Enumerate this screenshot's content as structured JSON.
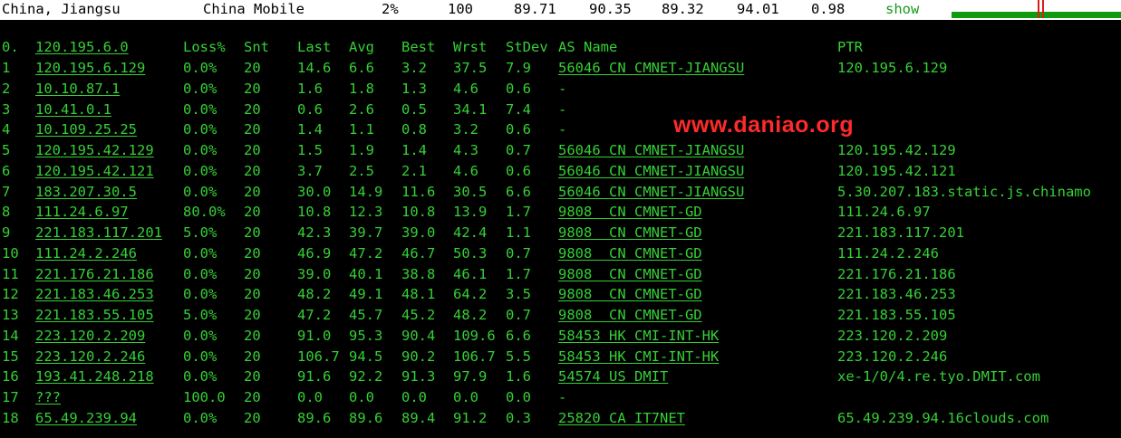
{
  "topbar": {
    "location": "China, Jiangsu",
    "isp": "China Mobile",
    "loss": "2%",
    "snt": "100",
    "last": "89.71",
    "avg": "90.35",
    "best": "89.32",
    "wrst": "94.01",
    "stdev": "0.98",
    "show_label": "show",
    "colors": {
      "track": "#0f9a0f",
      "mark": "#e01818"
    }
  },
  "headers": {
    "hop": "0.",
    "host": "120.195.6.0",
    "loss": "Loss%",
    "snt": "Snt",
    "last": "Last",
    "avg": "Avg",
    "best": "Best",
    "wrst": "Wrst",
    "stdev": "StDev",
    "as": "AS Name",
    "ptr": "PTR"
  },
  "watermark": "www.daniao.org",
  "rows": [
    {
      "hop": "1",
      "host": "120.195.6.129",
      "loss": "0.0%",
      "snt": "20",
      "last": "14.6",
      "avg": "6.6",
      "best": "3.2",
      "wrst": "37.5",
      "stdev": "7.9",
      "as": "56046 CN CMNET-JIANGSU",
      "ptr": "120.195.6.129"
    },
    {
      "hop": "2",
      "host": "10.10.87.1",
      "loss": "0.0%",
      "snt": "20",
      "last": "1.6",
      "avg": "1.8",
      "best": "1.3",
      "wrst": "4.6",
      "stdev": "0.6",
      "as": "-",
      "ptr": ""
    },
    {
      "hop": "3",
      "host": "10.41.0.1",
      "loss": "0.0%",
      "snt": "20",
      "last": "0.6",
      "avg": "2.6",
      "best": "0.5",
      "wrst": "34.1",
      "stdev": "7.4",
      "as": "-",
      "ptr": ""
    },
    {
      "hop": "4",
      "host": "10.109.25.25",
      "loss": "0.0%",
      "snt": "20",
      "last": "1.4",
      "avg": "1.1",
      "best": "0.8",
      "wrst": "3.2",
      "stdev": "0.6",
      "as": "-",
      "ptr": ""
    },
    {
      "hop": "5",
      "host": "120.195.42.129",
      "loss": "0.0%",
      "snt": "20",
      "last": "1.5",
      "avg": "1.9",
      "best": "1.4",
      "wrst": "4.3",
      "stdev": "0.7",
      "as": "56046 CN CMNET-JIANGSU",
      "ptr": "120.195.42.129"
    },
    {
      "hop": "6",
      "host": "120.195.42.121",
      "loss": "0.0%",
      "snt": "20",
      "last": "3.7",
      "avg": "2.5",
      "best": "2.1",
      "wrst": "4.6",
      "stdev": "0.6",
      "as": "56046 CN CMNET-JIANGSU",
      "ptr": "120.195.42.121"
    },
    {
      "hop": "7",
      "host": "183.207.30.5",
      "loss": "0.0%",
      "snt": "20",
      "last": "30.0",
      "avg": "14.9",
      "best": "11.6",
      "wrst": "30.5",
      "stdev": "6.6",
      "as": "56046 CN CMNET-JIANGSU",
      "ptr": "5.30.207.183.static.js.chinamo"
    },
    {
      "hop": "8",
      "host": "111.24.6.97",
      "loss": "80.0%",
      "snt": "20",
      "last": "10.8",
      "avg": "12.3",
      "best": "10.8",
      "wrst": "13.9",
      "stdev": "1.7",
      "as": "9808  CN CMNET-GD",
      "ptr": "111.24.6.97"
    },
    {
      "hop": "9",
      "host": "221.183.117.201",
      "loss": "5.0%",
      "snt": "20",
      "last": "42.3",
      "avg": "39.7",
      "best": "39.0",
      "wrst": "42.4",
      "stdev": "1.1",
      "as": "9808  CN CMNET-GD",
      "ptr": "221.183.117.201"
    },
    {
      "hop": "10",
      "host": "111.24.2.246",
      "loss": "0.0%",
      "snt": "20",
      "last": "46.9",
      "avg": "47.2",
      "best": "46.7",
      "wrst": "50.3",
      "stdev": "0.7",
      "as": "9808  CN CMNET-GD",
      "ptr": "111.24.2.246"
    },
    {
      "hop": "11",
      "host": "221.176.21.186",
      "loss": "0.0%",
      "snt": "20",
      "last": "39.0",
      "avg": "40.1",
      "best": "38.8",
      "wrst": "46.1",
      "stdev": "1.7",
      "as": "9808  CN CMNET-GD",
      "ptr": "221.176.21.186"
    },
    {
      "hop": "12",
      "host": "221.183.46.253",
      "loss": "0.0%",
      "snt": "20",
      "last": "48.2",
      "avg": "49.1",
      "best": "48.1",
      "wrst": "64.2",
      "stdev": "3.5",
      "as": "9808  CN CMNET-GD",
      "ptr": "221.183.46.253"
    },
    {
      "hop": "13",
      "host": "221.183.55.105",
      "loss": "5.0%",
      "snt": "20",
      "last": "47.2",
      "avg": "45.7",
      "best": "45.2",
      "wrst": "48.2",
      "stdev": "0.7",
      "as": "9808  CN CMNET-GD",
      "ptr": "221.183.55.105"
    },
    {
      "hop": "14",
      "host": "223.120.2.209",
      "loss": "0.0%",
      "snt": "20",
      "last": "91.0",
      "avg": "95.3",
      "best": "90.4",
      "wrst": "109.6",
      "stdev": "6.6",
      "as": "58453 HK CMI-INT-HK",
      "ptr": "223.120.2.209"
    },
    {
      "hop": "15",
      "host": "223.120.2.246",
      "loss": "0.0%",
      "snt": "20",
      "last": "106.7",
      "avg": "94.5",
      "best": "90.2",
      "wrst": "106.7",
      "stdev": "5.5",
      "as": "58453 HK CMI-INT-HK",
      "ptr": "223.120.2.246"
    },
    {
      "hop": "16",
      "host": "193.41.248.218",
      "loss": "0.0%",
      "snt": "20",
      "last": "91.6",
      "avg": "92.2",
      "best": "91.3",
      "wrst": "97.9",
      "stdev": "1.6",
      "as": "54574 US DMIT",
      "ptr": "xe-1/0/4.re.tyo.DMIT.com"
    },
    {
      "hop": "17",
      "host": "???",
      "loss": "100.0",
      "snt": "20",
      "last": "0.0",
      "avg": "0.0",
      "best": "0.0",
      "wrst": "0.0",
      "stdev": "0.0",
      "as": "-",
      "ptr": ""
    },
    {
      "hop": "18",
      "host": "65.49.239.94",
      "loss": "0.0%",
      "snt": "20",
      "last": "89.6",
      "avg": "89.6",
      "best": "89.4",
      "wrst": "91.2",
      "stdev": "0.3",
      "as": "25820 CA IT7NET",
      "ptr": "65.49.239.94.16clouds.com"
    }
  ]
}
